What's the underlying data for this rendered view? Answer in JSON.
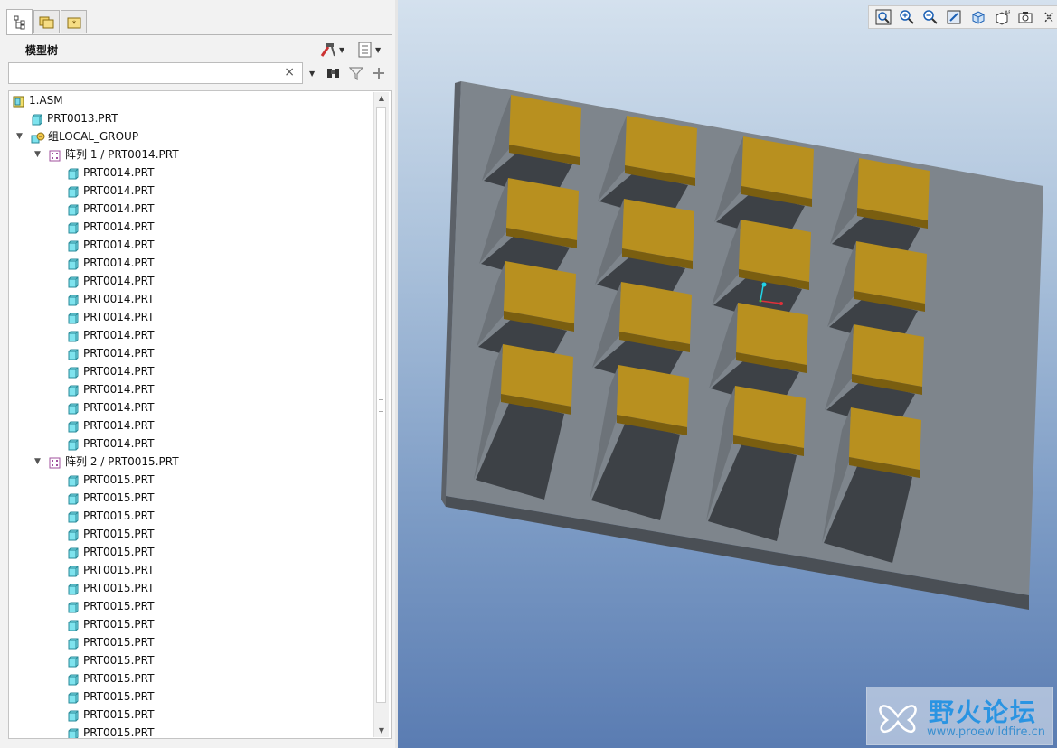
{
  "panel": {
    "tabs": [
      "model-tree-tab",
      "folder-browser-tab",
      "favorites-tab"
    ],
    "title": "模型树",
    "search": {
      "value": "",
      "clear_glyph": "×"
    }
  },
  "tree": {
    "rows": [
      {
        "label": "1.ASM",
        "level": 0,
        "icon": "assembly-icon",
        "twisty": ""
      },
      {
        "label": "PRT0013.PRT",
        "level": 1,
        "icon": "part-icon",
        "twisty": ""
      },
      {
        "label": "组LOCAL_GROUP",
        "level": 0,
        "icon": "group-icon",
        "twisty": "▼"
      },
      {
        "label": "阵列 1 / PRT0014.PRT",
        "level": 1,
        "icon": "pattern-icon",
        "twisty": "▼"
      },
      {
        "label": "PRT0014.PRT",
        "level": 2,
        "icon": "part-icon",
        "twisty": ""
      },
      {
        "label": "PRT0014.PRT",
        "level": 2,
        "icon": "part-icon",
        "twisty": ""
      },
      {
        "label": "PRT0014.PRT",
        "level": 2,
        "icon": "part-icon",
        "twisty": ""
      },
      {
        "label": "PRT0014.PRT",
        "level": 2,
        "icon": "part-icon",
        "twisty": ""
      },
      {
        "label": "PRT0014.PRT",
        "level": 2,
        "icon": "part-icon",
        "twisty": ""
      },
      {
        "label": "PRT0014.PRT",
        "level": 2,
        "icon": "part-icon",
        "twisty": ""
      },
      {
        "label": "PRT0014.PRT",
        "level": 2,
        "icon": "part-icon",
        "twisty": ""
      },
      {
        "label": "PRT0014.PRT",
        "level": 2,
        "icon": "part-icon",
        "twisty": ""
      },
      {
        "label": "PRT0014.PRT",
        "level": 2,
        "icon": "part-icon",
        "twisty": ""
      },
      {
        "label": "PRT0014.PRT",
        "level": 2,
        "icon": "part-icon",
        "twisty": ""
      },
      {
        "label": "PRT0014.PRT",
        "level": 2,
        "icon": "part-icon",
        "twisty": ""
      },
      {
        "label": "PRT0014.PRT",
        "level": 2,
        "icon": "part-icon",
        "twisty": ""
      },
      {
        "label": "PRT0014.PRT",
        "level": 2,
        "icon": "part-icon",
        "twisty": ""
      },
      {
        "label": "PRT0014.PRT",
        "level": 2,
        "icon": "part-icon",
        "twisty": ""
      },
      {
        "label": "PRT0014.PRT",
        "level": 2,
        "icon": "part-icon",
        "twisty": ""
      },
      {
        "label": "PRT0014.PRT",
        "level": 2,
        "icon": "part-icon",
        "twisty": ""
      },
      {
        "label": "阵列 2 / PRT0015.PRT",
        "level": 1,
        "icon": "pattern-icon",
        "twisty": "▼"
      },
      {
        "label": "PRT0015.PRT",
        "level": 2,
        "icon": "part-icon",
        "twisty": ""
      },
      {
        "label": "PRT0015.PRT",
        "level": 2,
        "icon": "part-icon",
        "twisty": ""
      },
      {
        "label": "PRT0015.PRT",
        "level": 2,
        "icon": "part-icon",
        "twisty": ""
      },
      {
        "label": "PRT0015.PRT",
        "level": 2,
        "icon": "part-icon",
        "twisty": ""
      },
      {
        "label": "PRT0015.PRT",
        "level": 2,
        "icon": "part-icon",
        "twisty": ""
      },
      {
        "label": "PRT0015.PRT",
        "level": 2,
        "icon": "part-icon",
        "twisty": ""
      },
      {
        "label": "PRT0015.PRT",
        "level": 2,
        "icon": "part-icon",
        "twisty": ""
      },
      {
        "label": "PRT0015.PRT",
        "level": 2,
        "icon": "part-icon",
        "twisty": ""
      },
      {
        "label": "PRT0015.PRT",
        "level": 2,
        "icon": "part-icon",
        "twisty": ""
      },
      {
        "label": "PRT0015.PRT",
        "level": 2,
        "icon": "part-icon",
        "twisty": ""
      },
      {
        "label": "PRT0015.PRT",
        "level": 2,
        "icon": "part-icon",
        "twisty": ""
      },
      {
        "label": "PRT0015.PRT",
        "level": 2,
        "icon": "part-icon",
        "twisty": ""
      },
      {
        "label": "PRT0015.PRT",
        "level": 2,
        "icon": "part-icon",
        "twisty": ""
      },
      {
        "label": "PRT0015.PRT",
        "level": 2,
        "icon": "part-icon",
        "twisty": ""
      },
      {
        "label": "PRT0015.PRT",
        "level": 2,
        "icon": "part-icon",
        "twisty": ""
      }
    ]
  },
  "view_toolbar": {
    "buttons": [
      "zoom-fit-icon",
      "zoom-in-icon",
      "zoom-out-icon",
      "repaint-icon",
      "display-style-icon",
      "saved-views-icon",
      "camera-icon",
      "more-icon"
    ]
  },
  "viewport": {
    "colors": {
      "plate_top": "#7e858c",
      "plate_front": "#4a4f55",
      "block_top": "#b8901f",
      "block_front": "#7a5e10",
      "shadow": "#3d4146"
    }
  },
  "watermark": {
    "title": "野火论坛",
    "url": "www.proewildfire.cn"
  }
}
